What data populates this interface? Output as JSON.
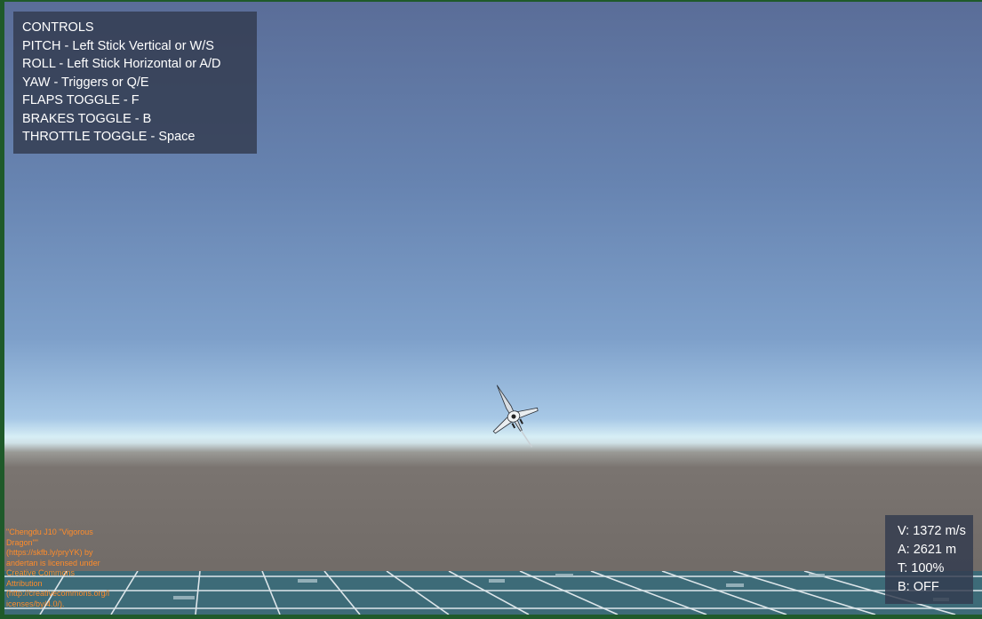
{
  "controls": {
    "title": "CONTROLS",
    "items": [
      "PITCH - Left Stick Vertical or W/S",
      "ROLL - Left Stick Horizontal or A/D",
      "YAW - Triggers or Q/E",
      "FLAPS TOGGLE - F",
      "BRAKES TOGGLE - B",
      "THROTTLE TOGGLE - Space"
    ]
  },
  "hud": {
    "velocity": "V: 1372 m/s",
    "altitude": "A: 2621 m",
    "throttle": "T: 100%",
    "brakes": "B: OFF"
  },
  "attribution": {
    "text": "\"Chengdu J10 \"Vigorous Dragon\"\" (https://skfb.ly/pryYK) by andertan is licensed under Creative Commons Attribution (http://creativecommons.org/licenses/by/4.0/)."
  },
  "colors": {
    "panel_bg": "#323a4e",
    "attribution_text": "#ff8c2a",
    "frame_border": "#1f5a2a",
    "ground_grid": "#3d6b78"
  },
  "icons": {
    "aircraft": "fighter-jet-icon"
  }
}
